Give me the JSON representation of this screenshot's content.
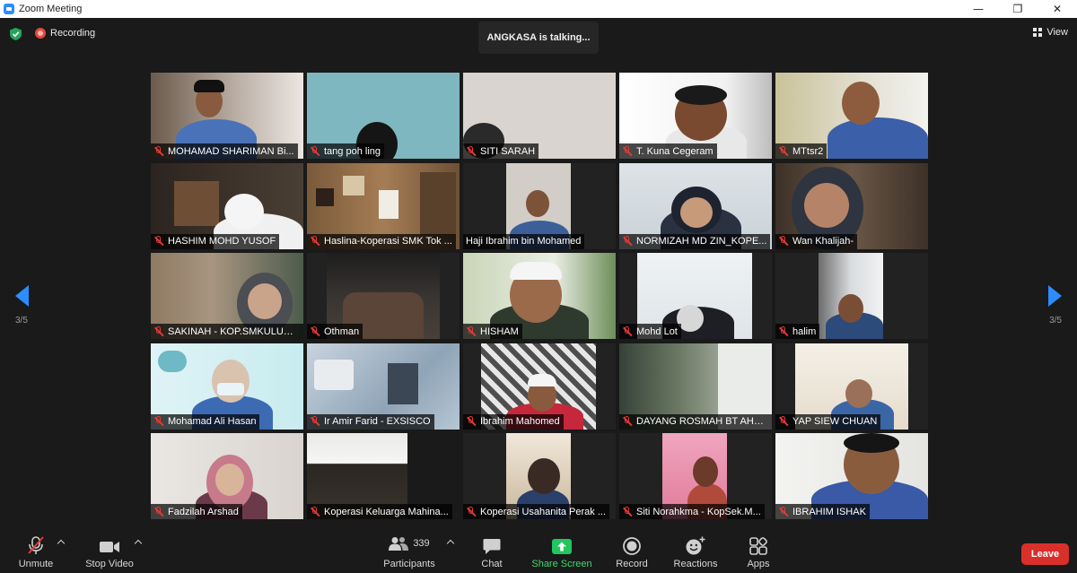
{
  "window": {
    "title": "Zoom Meeting",
    "minimize": "—",
    "maximize": "❐",
    "close": "✕"
  },
  "overlay": {
    "recording_label": "Recording",
    "talking_text": "ANGKASA is talking...",
    "view_label": "View",
    "page_indicator": "3/5"
  },
  "participants": [
    {
      "name": "MOHAMAD SHARIMAN Bi...",
      "muted": true
    },
    {
      "name": "tang poh ling",
      "muted": true
    },
    {
      "name": "SITI SARAH",
      "muted": true
    },
    {
      "name": "T. Kuna Cegeram",
      "muted": true
    },
    {
      "name": "MTtsr2",
      "muted": true
    },
    {
      "name": "HASHIM MOHD YUSOF",
      "muted": true
    },
    {
      "name": "Haslina-Koperasi SMK Tok ...",
      "muted": true
    },
    {
      "name": "Haji Ibrahim bin Mohamed",
      "muted": false
    },
    {
      "name": "NORMIZAH MD ZIN_KOPE...",
      "muted": true
    },
    {
      "name": "Wan Khalijah-",
      "muted": true
    },
    {
      "name": "SAKINAH - KOP.SMKULUBE...",
      "muted": true
    },
    {
      "name": "Othman",
      "muted": true
    },
    {
      "name": "HISHAM",
      "muted": true
    },
    {
      "name": "Mohd Lot",
      "muted": true
    },
    {
      "name": "halim",
      "muted": true
    },
    {
      "name": "Mohamad Ali Hasan",
      "muted": true
    },
    {
      "name": "Ir Amir Farid - EXSISCO",
      "muted": true
    },
    {
      "name": "Ibrahim Mahomed",
      "muted": true
    },
    {
      "name": "DAYANG ROSMAH BT AHM...",
      "muted": true
    },
    {
      "name": "YAP SIEW CHUAN",
      "muted": true
    },
    {
      "name": "Fadzilah Arshad",
      "muted": true
    },
    {
      "name": "Koperasi Keluarga Mahina...",
      "muted": true
    },
    {
      "name": "Koperasi Usahanita Perak ...",
      "muted": true
    },
    {
      "name": "Siti Norahkma - KopSek.M...",
      "muted": true
    },
    {
      "name": "IBRAHIM ISHAK",
      "muted": true
    }
  ],
  "toolbar": {
    "unmute_label": "Unmute",
    "stop_video_label": "Stop Video",
    "participants_label": "Participants",
    "participants_count": "339",
    "chat_label": "Chat",
    "share_screen_label": "Share Screen",
    "record_label": "Record",
    "reactions_label": "Reactions",
    "apps_label": "Apps",
    "leave_label": "Leave"
  },
  "colors": {
    "accent": "#2d8cff",
    "share_green": "#22c55e",
    "leave_red": "#d9302c",
    "mute_red": "#e53935"
  }
}
